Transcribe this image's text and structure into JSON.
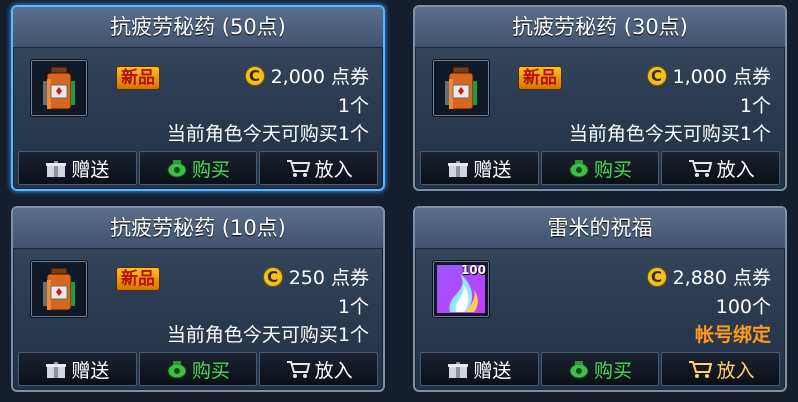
{
  "colors": {
    "accent_green": "#4bdb50",
    "price_coin": "#f1c21a",
    "limit_orange": "#ff9a1a",
    "selected_border": "#58b8ff"
  },
  "items": [
    {
      "title": "抗疲劳秘药 (50点)",
      "badge": "新品",
      "price": "2,000 点券",
      "quantity": "1个",
      "limit": "当前角色今天可购买1个",
      "icon": "potion-icon",
      "buttons": {
        "gift": "赠送",
        "buy": "购买",
        "cart": "放入"
      }
    },
    {
      "title": "抗疲劳秘药 (30点)",
      "badge": "新品",
      "price": "1,000 点券",
      "quantity": "1个",
      "limit": "当前角色今天可购买1个",
      "icon": "potion-icon",
      "buttons": {
        "gift": "赠送",
        "buy": "购买",
        "cart": "放入"
      }
    },
    {
      "title": "抗疲劳秘药 (10点)",
      "badge": "新品",
      "price": "250 点券",
      "quantity": "1个",
      "limit": "当前角色今天可购买1个",
      "icon": "potion-icon",
      "buttons": {
        "gift": "赠送",
        "buy": "购买",
        "cart": "放入"
      }
    },
    {
      "title": "雷米的祝福",
      "price": "2,880 点券",
      "quantity": "100个",
      "limit": "帐号绑定",
      "icon": "blessing-icon",
      "icon_count": "100",
      "buttons": {
        "gift": "赠送",
        "buy": "购买",
        "cart": "放入"
      }
    }
  ]
}
